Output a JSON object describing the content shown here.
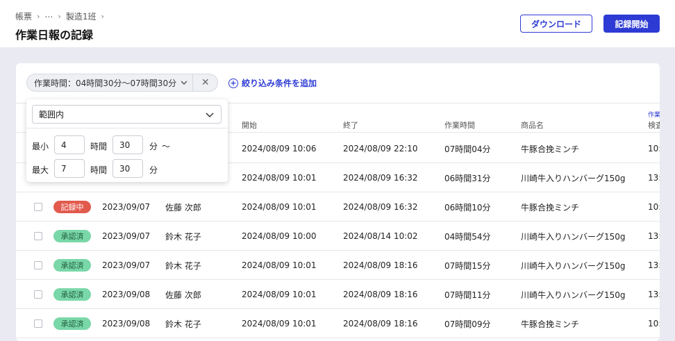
{
  "breadcrumb": [
    "帳票",
    "⋯",
    "製造1班"
  ],
  "breadcrumb_sep": "›",
  "page_title": "作業日報の記録",
  "buttons": {
    "download": "ダウンロード",
    "start": "記録開始"
  },
  "filter": {
    "chip_label": "作業時間：04時間30分〜07時間30分",
    "close": "✕",
    "add_label": "絞り込み条件を追加"
  },
  "popup": {
    "select_value": "範囲内",
    "min_label": "最小",
    "min_hours": "4",
    "min_minutes": "30",
    "max_label": "最大",
    "max_hours": "7",
    "max_minutes": "30",
    "hour_unit": "時間",
    "minute_unit": "分",
    "tilde": "〜"
  },
  "columns": {
    "start": "開始",
    "end": "終了",
    "work_time": "作業時間",
    "product": "商品名",
    "check": "検査",
    "partial_top": "作業"
  },
  "rows": [
    {
      "status": "",
      "date": "",
      "person": "",
      "start": "2024/08/09 10:06",
      "end": "2024/08/09 22:10",
      "work_time": "07時間04分",
      "product": "牛豚合挽ミンチ",
      "check": "10:"
    },
    {
      "status": "",
      "date": "",
      "person": "",
      "start": "2024/08/09 10:01",
      "end": "2024/08/09 16:32",
      "work_time": "06時間31分",
      "product": "川崎牛入りハンバーグ150g",
      "check": "13:"
    },
    {
      "status": "記録中",
      "date": "2023/09/07",
      "person": "佐藤 次郎",
      "start": "2024/08/09 10:01",
      "end": "2024/08/09 16:32",
      "work_time": "06時間10分",
      "product": "牛豚合挽ミンチ",
      "check": "10:"
    },
    {
      "status": "承認済",
      "date": "2023/09/07",
      "person": "鈴木 花子",
      "start": "2024/08/09 10:00",
      "end": "2024/08/14 10:02",
      "work_time": "04時間54分",
      "product": "川崎牛入りハンバーグ150g",
      "check": "13:"
    },
    {
      "status": "承認済",
      "date": "2023/09/07",
      "person": "鈴木 花子",
      "start": "2024/08/09 10:01",
      "end": "2024/08/09 18:16",
      "work_time": "07時間15分",
      "product": "川崎牛入りハンバーグ150g",
      "check": "13:"
    },
    {
      "status": "承認済",
      "date": "2023/09/08",
      "person": "佐藤 次郎",
      "start": "2024/08/09 10:01",
      "end": "2024/08/09 18:16",
      "work_time": "07時間11分",
      "product": "川崎牛入りハンバーグ150g",
      "check": "13:"
    },
    {
      "status": "承認済",
      "date": "2023/09/08",
      "person": "鈴木 花子",
      "start": "2024/08/09 10:01",
      "end": "2024/08/09 18:16",
      "work_time": "07時間09分",
      "product": "牛豚合挽ミンチ",
      "check": "10:"
    }
  ],
  "status_styles": {
    "記録中": {
      "bg": "#e25a4d",
      "fg": "#ffffff"
    },
    "承認済": {
      "bg": "#79d7a8",
      "fg": "#1f5c3d"
    }
  },
  "colors": {
    "accent": "#2d3bd4",
    "background": "#e9eaf2"
  },
  "icons": {
    "chevron": "chevron-down-icon",
    "close": "close-icon",
    "add": "plus-circle-icon"
  }
}
